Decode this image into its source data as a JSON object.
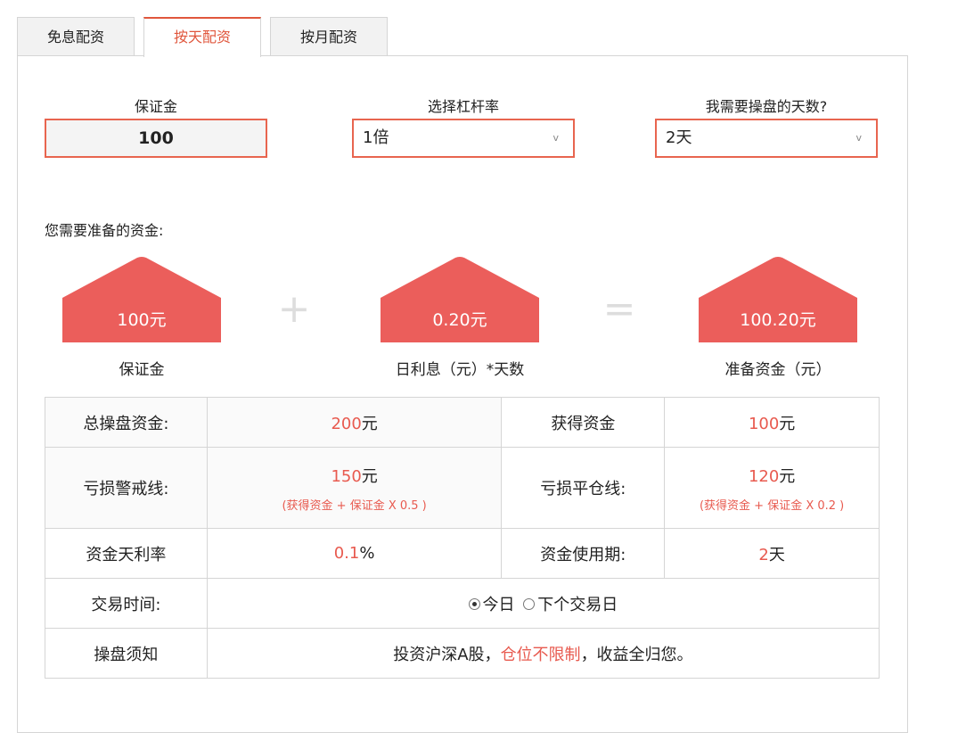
{
  "tabs": [
    {
      "label": "免息配资"
    },
    {
      "label": "按天配资"
    },
    {
      "label": "按月配资"
    }
  ],
  "active_tab": "按天配资",
  "form": {
    "deposit_label": "保证金",
    "deposit_value": "100",
    "leverage_label": "选择杠杆率",
    "leverage_value": "1倍",
    "days_label": "我需要操盘的天数?",
    "days_value": "2天",
    "dropdown_chevron": "v"
  },
  "prepare": {
    "title": "您需要准备的资金:",
    "plus_symbol": "+",
    "equals_symbol": "=",
    "items": [
      {
        "amount": "100元",
        "caption": "保证金"
      },
      {
        "amount": "0.20元",
        "caption": "日利息（元）*天数"
      },
      {
        "amount": "100.20元",
        "caption": "准备资金（元）"
      }
    ],
    "house_color": "#eb5e5b"
  },
  "table": {
    "total_label": "总操盘资金:",
    "total_value": "200",
    "total_unit": "元",
    "obtain_label": "获得资金",
    "obtain_value": "100",
    "obtain_unit": "元",
    "warn_label": "亏损警戒线:",
    "warn_value": "150",
    "warn_unit": "元",
    "warn_formula": "(获得资金 + 保证金 X 0.5 )",
    "close_label": "亏损平仓线:",
    "close_value": "120",
    "close_unit": "元",
    "close_formula": "(获得资金 + 保证金 X 0.2 )",
    "rate_label": "资金天利率",
    "rate_value": "0.1",
    "rate_unit": "%",
    "period_label": "资金使用期:",
    "period_value": "2",
    "period_unit": "天",
    "time_label": "交易时间:",
    "time_option_today": "今日",
    "time_option_next": "下个交易日",
    "time_selected": "今日",
    "notice_label": "操盘须知",
    "notice_prefix": "投资沪深A股，",
    "notice_highlight": "仓位不限制",
    "notice_suffix": "，收益全归您。"
  },
  "colors": {
    "accent": "#e0563c",
    "highlight": "#e85a4f"
  }
}
